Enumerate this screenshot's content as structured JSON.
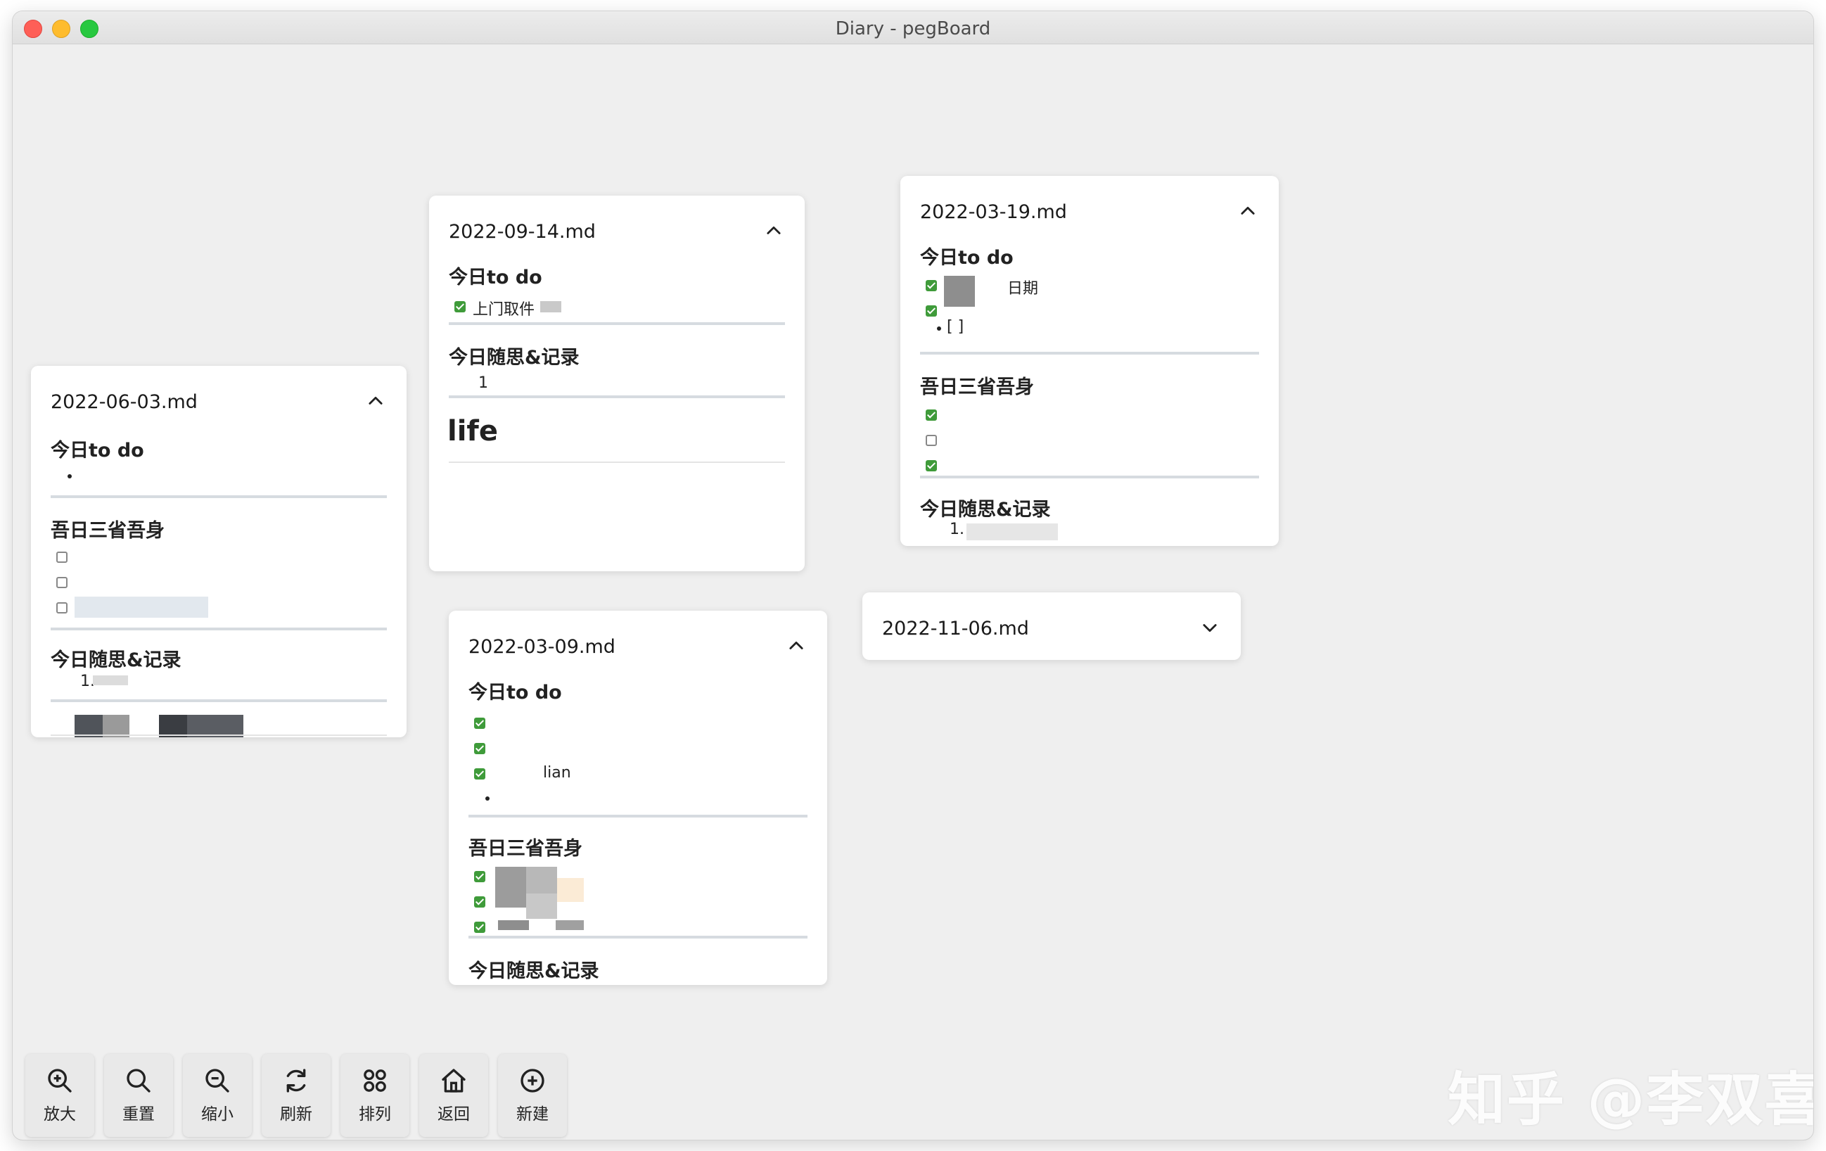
{
  "window": {
    "title": "Diary - pegBoard"
  },
  "sections": {
    "todo": "今日to do",
    "reflect": "吾日三省吾身",
    "notes": "今日随思&记录"
  },
  "cards": {
    "c0603": {
      "title": "2022-06-03.md",
      "note1": "1."
    },
    "c0914": {
      "title": "2022-09-14.md",
      "todo1": "上门取件",
      "note1": "1",
      "life": "life"
    },
    "c0319": {
      "title": "2022-03-19.md",
      "todo1": "日期",
      "bullet": "[ ]",
      "note1": "1."
    },
    "c0309": {
      "title": "2022-03-09.md",
      "todo3": "lian"
    },
    "c1106": {
      "title": "2022-11-06.md"
    }
  },
  "toolbar": [
    {
      "label": "放大",
      "icon": "zoom-in-icon"
    },
    {
      "label": "重置",
      "icon": "search-icon"
    },
    {
      "label": "缩小",
      "icon": "zoom-out-icon"
    },
    {
      "label": "刷新",
      "icon": "refresh-icon"
    },
    {
      "label": "排列",
      "icon": "grid-icon"
    },
    {
      "label": "返回",
      "icon": "home-icon"
    },
    {
      "label": "新建",
      "icon": "add-circle-icon"
    }
  ],
  "watermark": "知乎 @李双喜"
}
